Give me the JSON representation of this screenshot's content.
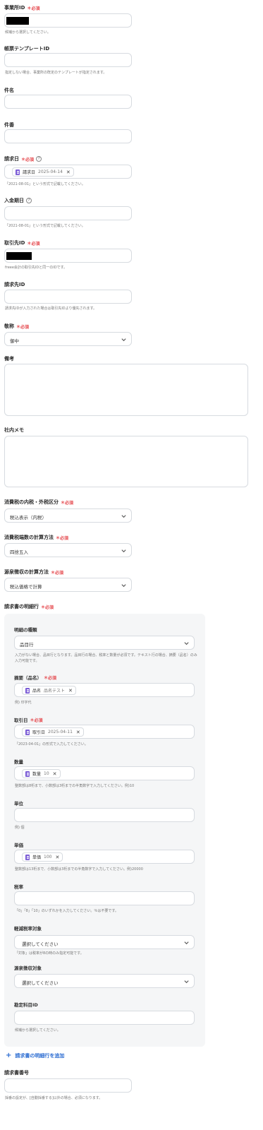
{
  "fields": {
    "office_id": {
      "label": "事業所ID",
      "required": "必須",
      "hint": "候補から選択してください。"
    },
    "template_id": {
      "label": "帳票テンプレートID",
      "hint": "指定しない場合、事業所の既定のテンプレートが指定されます。"
    },
    "subject": {
      "label": "件名"
    },
    "title": {
      "label": "件番"
    },
    "billing_date": {
      "label": "請求日",
      "required": "必須",
      "chip_label": "請求日",
      "chip_value": "2025-04-14",
      "hint": "「2021-08-01」という形式で記載してください。"
    },
    "due_date": {
      "label": "入金期日",
      "hint": "「2021-08-01」という形式で記載してください。"
    },
    "partner_id": {
      "label": "取引先ID",
      "required": "必須",
      "hint": "freee会計の取引先IDと同一のIDです。"
    },
    "billing_to_id": {
      "label": "請求先ID",
      "hint": "請求先IDが入力された場合は取引先IDより優先されます。"
    },
    "honorific": {
      "label": "敬称",
      "required": "必須",
      "value": "御中"
    },
    "notes": {
      "label": "備考"
    },
    "internal_memo": {
      "label": "社内メモ"
    },
    "tax_entry": {
      "label": "消費税の内税・外税区分",
      "required": "必須",
      "value": "税込表示（内税）"
    },
    "tax_rounding": {
      "label": "消費税端数の計算方法",
      "required": "必須",
      "value": "四捨五入"
    },
    "withholding_calc": {
      "label": "源泉徴収の計算方法",
      "required": "必須",
      "value": "税込価格で計算"
    },
    "lines_label": "請求書の明細行",
    "lines_required": "必須"
  },
  "line_item": {
    "type": {
      "label": "明細の種類",
      "value": "品目行",
      "hint1": "入力がない場合、品目行となります。品目行の場合、税率と数量が必須です。テキスト行の場合、摘要（品名）のみ",
      "hint2": "入力可能です。"
    },
    "description": {
      "label": "摘要（品名）",
      "required": "必須",
      "chip_label": "品名",
      "chip_value": "品名テスト",
      "hint": "例) 印字代"
    },
    "sales_date": {
      "label": "取引日",
      "required": "必須",
      "chip_label": "取引日",
      "chip_value": "2025-04-11",
      "hint": "「2023-04-01」の形式で入力してください。"
    },
    "quantity": {
      "label": "数量",
      "chip_label": "数量",
      "chip_value": "10",
      "hint": "整数部は8桁まで、小数部は3桁までの半角数字で入力してください。例)10"
    },
    "unit": {
      "label": "単位",
      "hint": "例) 個"
    },
    "unit_price": {
      "label": "単価",
      "chip_label": "単価",
      "chip_value": "100",
      "hint": "整数部は13桁まで、小数部は3桁までの半角数字で入力してください。例)20000"
    },
    "tax_rate": {
      "label": "税率",
      "hint": "「0」「8」「10」のいずれかを入力してください。％は不要です。"
    },
    "reduced_tax": {
      "label": "軽減税率対象",
      "value": "選択してください",
      "hint": "「対象」は税率が8の時のみ指定可能です。"
    },
    "withholding": {
      "label": "源泉徴収対象",
      "value": "選択してください"
    },
    "account_item_id": {
      "label": "勘定科目ID",
      "hint": "候補から選択してください。"
    }
  },
  "add_line_label": "請求書の明細行を追加",
  "invoice_number": {
    "label": "請求書番号",
    "hint": "採番の設定が、[自動採番する]以外の場合、必須になります。"
  },
  "icons": {
    "required_marker": "asterisk-icon",
    "help": "question-circle-icon",
    "select": "chevron-down-icon",
    "chip_doc": "document-icon",
    "chip_remove": "close-icon",
    "add": "plus-icon"
  },
  "colors": {
    "required": "#e5484d",
    "accent_link": "#2a6bd1",
    "chip_icon": "#7b5cd6",
    "panel_bg": "#f5f6f7"
  },
  "glyphs": {
    "asterisk": "＊",
    "help": "?",
    "close": "✕",
    "plus": "+"
  }
}
